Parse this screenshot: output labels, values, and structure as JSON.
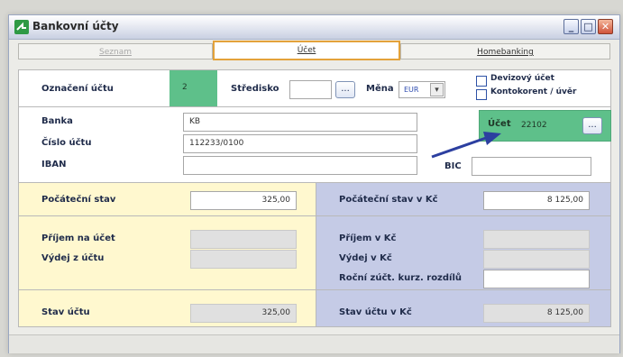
{
  "window": {
    "title": "Bankovní účty"
  },
  "tabs": [
    {
      "label": "Seznam"
    },
    {
      "label": "Účet"
    },
    {
      "label": "Homebanking"
    }
  ],
  "account_header": {
    "label": "Označení účtu",
    "value": "2",
    "center_label": "Středisko",
    "center_value": "",
    "center_btn": "...",
    "currency_label": "Měna",
    "currency_value": "EUR",
    "currency_arrow": "▾",
    "foreign_account": "Devizový účet",
    "overdraft": "Kontokorent / úvěr"
  },
  "bank": {
    "bank_label": "Banka",
    "bank_value": "KB",
    "number_label": "Číslo účtu",
    "number_value": "112233/0100",
    "iban_label": "IBAN",
    "iban_value": "",
    "bic_label": "BIC",
    "bic_value": "",
    "ucet_label": "Účet",
    "ucet_value": "22102",
    "ucet_btn": "..."
  },
  "balances": {
    "start_label": "Počáteční stav",
    "start_value": "325,00",
    "start_czk_label": "Počáteční stav v Kč",
    "start_czk_value": "8 125,00",
    "income_label": "Příjem na účet",
    "expense_label": "Výdej z účtu",
    "income_czk_label": "Příjem v Kč",
    "expense_czk_label": "Výdej v Kč",
    "rate_diff_label": "Roční zúčt. kurz. rozdílů",
    "state_label": "Stav účtu",
    "state_value": "325,00",
    "state_czk_label": "Stav účtu v Kč",
    "state_czk_value": "8 125,00"
  },
  "colors": {
    "accent_green": "#5ec08a",
    "yellow_panel": "#fff8cf",
    "blue_panel": "#c5cbe6",
    "arrow": "#2c3fa0"
  }
}
